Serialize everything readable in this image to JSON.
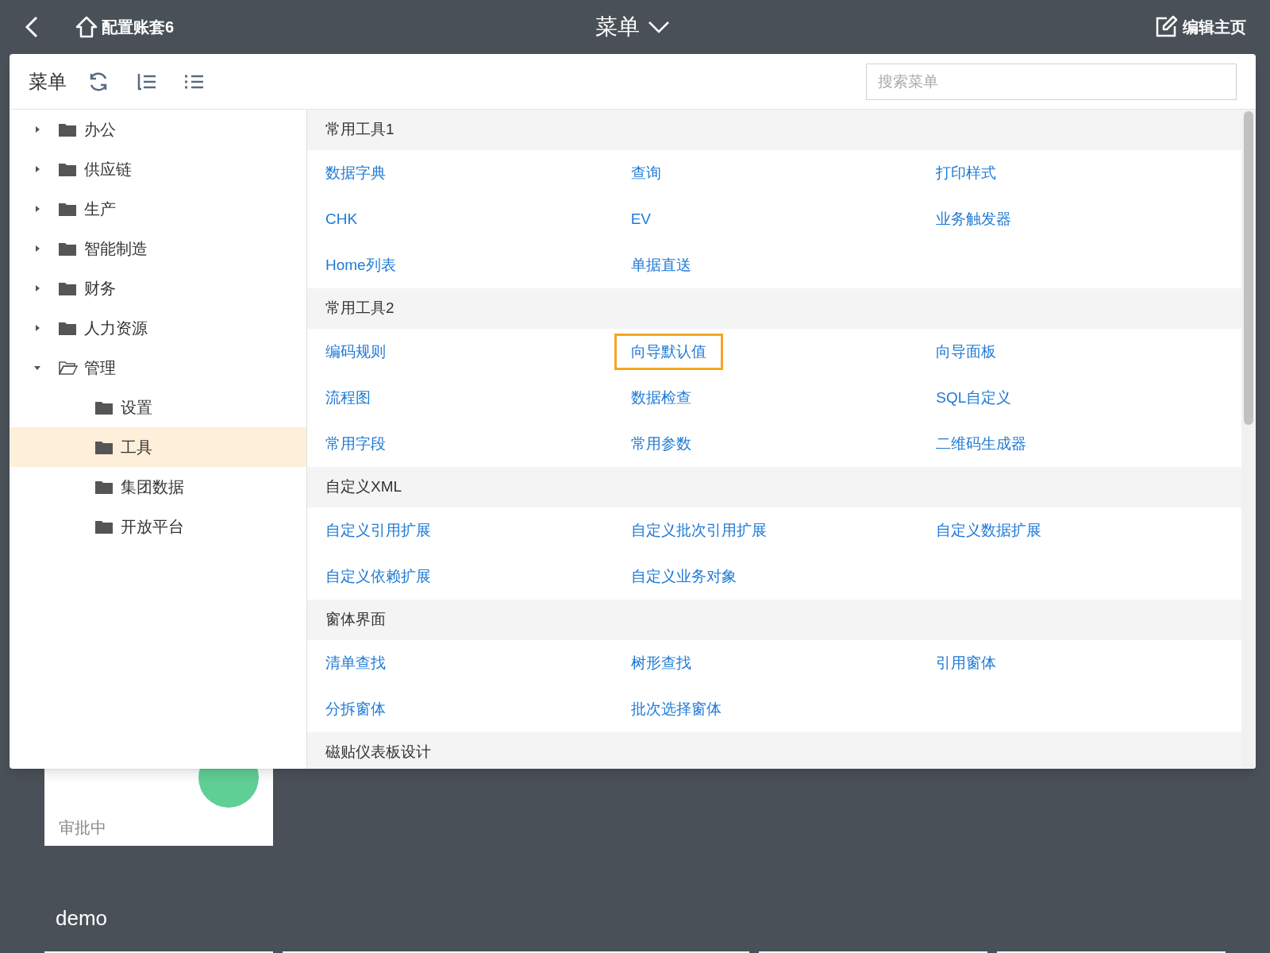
{
  "header": {
    "account": "配置账套6",
    "title": "菜单",
    "edit": "编辑主页"
  },
  "panel": {
    "toolbar_title": "菜单",
    "search": {
      "placeholder": "搜索菜单"
    },
    "tree": [
      {
        "label": "办公",
        "expanded": false,
        "selected": false
      },
      {
        "label": "供应链",
        "expanded": false,
        "selected": false
      },
      {
        "label": "生产",
        "expanded": false,
        "selected": false
      },
      {
        "label": "智能制造",
        "expanded": false,
        "selected": false
      },
      {
        "label": "财务",
        "expanded": false,
        "selected": false
      },
      {
        "label": "人力资源",
        "expanded": false,
        "selected": false
      },
      {
        "label": "管理",
        "expanded": true,
        "selected": false,
        "children": [
          {
            "label": "设置",
            "selected": false
          },
          {
            "label": "工具",
            "selected": true
          },
          {
            "label": "集团数据",
            "selected": false
          },
          {
            "label": "开放平台",
            "selected": false
          }
        ]
      }
    ],
    "sections": [
      {
        "title": "常用工具1",
        "items": [
          {
            "label": "数据字典",
            "highlighted": false
          },
          {
            "label": "查询",
            "highlighted": false
          },
          {
            "label": "打印样式",
            "highlighted": false
          },
          {
            "label": "CHK",
            "highlighted": false
          },
          {
            "label": "EV",
            "highlighted": false
          },
          {
            "label": "业务触发器",
            "highlighted": false
          },
          {
            "label": "Home列表",
            "highlighted": false
          },
          {
            "label": "单据直送",
            "highlighted": false
          }
        ]
      },
      {
        "title": "常用工具2",
        "items": [
          {
            "label": "编码规则",
            "highlighted": false
          },
          {
            "label": "向导默认值",
            "highlighted": true
          },
          {
            "label": "向导面板",
            "highlighted": false
          },
          {
            "label": "流程图",
            "highlighted": false
          },
          {
            "label": "数据检查",
            "highlighted": false
          },
          {
            "label": "SQL自定义",
            "highlighted": false
          },
          {
            "label": "常用字段",
            "highlighted": false
          },
          {
            "label": "常用参数",
            "highlighted": false
          },
          {
            "label": "二维码生成器",
            "highlighted": false
          }
        ]
      },
      {
        "title": "自定义XML",
        "items": [
          {
            "label": "自定义引用扩展",
            "highlighted": false
          },
          {
            "label": "自定义批次引用扩展",
            "highlighted": false
          },
          {
            "label": "自定义数据扩展",
            "highlighted": false
          },
          {
            "label": "自定义依赖扩展",
            "highlighted": false
          },
          {
            "label": "自定义业务对象",
            "highlighted": false
          }
        ]
      },
      {
        "title": "窗体界面",
        "items": [
          {
            "label": "清单查找",
            "highlighted": false
          },
          {
            "label": "树形查找",
            "highlighted": false
          },
          {
            "label": "引用窗体",
            "highlighted": false
          },
          {
            "label": "分拆窗体",
            "highlighted": false
          },
          {
            "label": "批次选择窗体",
            "highlighted": false
          }
        ]
      },
      {
        "title": "磁贴仪表板设计"
      }
    ]
  },
  "dashboard": {
    "card": {
      "label": "审批中"
    },
    "group_title": "demo"
  }
}
